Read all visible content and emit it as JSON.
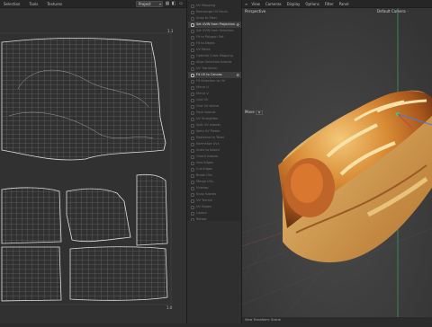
{
  "uv_editor": {
    "menu": [
      "Selection",
      "Tools",
      "Textures"
    ],
    "dropdown_value": "Project",
    "tick_top_right": "1.1",
    "tick_bottom_right": "1.0"
  },
  "panel": {
    "items": [
      {
        "label": "UV Mapping"
      },
      {
        "label": "Rearrange UV Faces"
      },
      {
        "label": "Snap to Pixel"
      },
      {
        "label": "Set UVW from Projection",
        "highlight": true
      },
      {
        "label": "Set UVW from Selection"
      },
      {
        "label": "Fit to Polygon Set"
      },
      {
        "label": "Fit to Edges"
      },
      {
        "label": "UV Relax"
      },
      {
        "label": "Optimal Cubic Mapping"
      },
      {
        "label": "Align Selection Islands"
      },
      {
        "label": "UV Transform"
      },
      {
        "label": "Fit UV to Canvas",
        "highlight": true
      },
      {
        "label": "Fit Selection to UV"
      },
      {
        "label": "Mirror U"
      },
      {
        "label": "Mirror V"
      },
      {
        "label": "Grid UV"
      },
      {
        "label": "Grid UV Island"
      },
      {
        "label": "Pack Islands"
      },
      {
        "label": "UV Straighten"
      },
      {
        "label": "Split UV Islands"
      },
      {
        "label": "Weld UV Points"
      },
      {
        "label": "Rasterize to Texel"
      },
      {
        "label": "Normalize UVs"
      },
      {
        "label": "Scale to Island"
      },
      {
        "label": "Orient Islands"
      },
      {
        "label": "Sew Edges"
      },
      {
        "label": "Cut Edges"
      },
      {
        "label": "Break UVs"
      },
      {
        "label": "Merge UVs"
      },
      {
        "label": "Unwrap"
      },
      {
        "label": "Snap Islands"
      },
      {
        "label": "UV Terrain"
      },
      {
        "label": "UV Edges"
      },
      {
        "label": "Layout"
      },
      {
        "label": "Rotate"
      }
    ]
  },
  "viewport": {
    "menu": [
      "View",
      "Cameras",
      "Display",
      "Options",
      "Filter",
      "Panel"
    ],
    "view_name": "Perspective",
    "camera": "Default Camera",
    "camera_icon": "◦",
    "move_label": "Move",
    "status": "View Transform: Scene"
  },
  "colors": {
    "bg": "#2b2b2b",
    "uv_bg": "#313131",
    "vp_bg": "#3a3a3a",
    "highlight": "#3d3d3d",
    "axis_green": "#3ad06a",
    "axis_blue": "#3f7fe0",
    "axis_red": "#d04040"
  }
}
